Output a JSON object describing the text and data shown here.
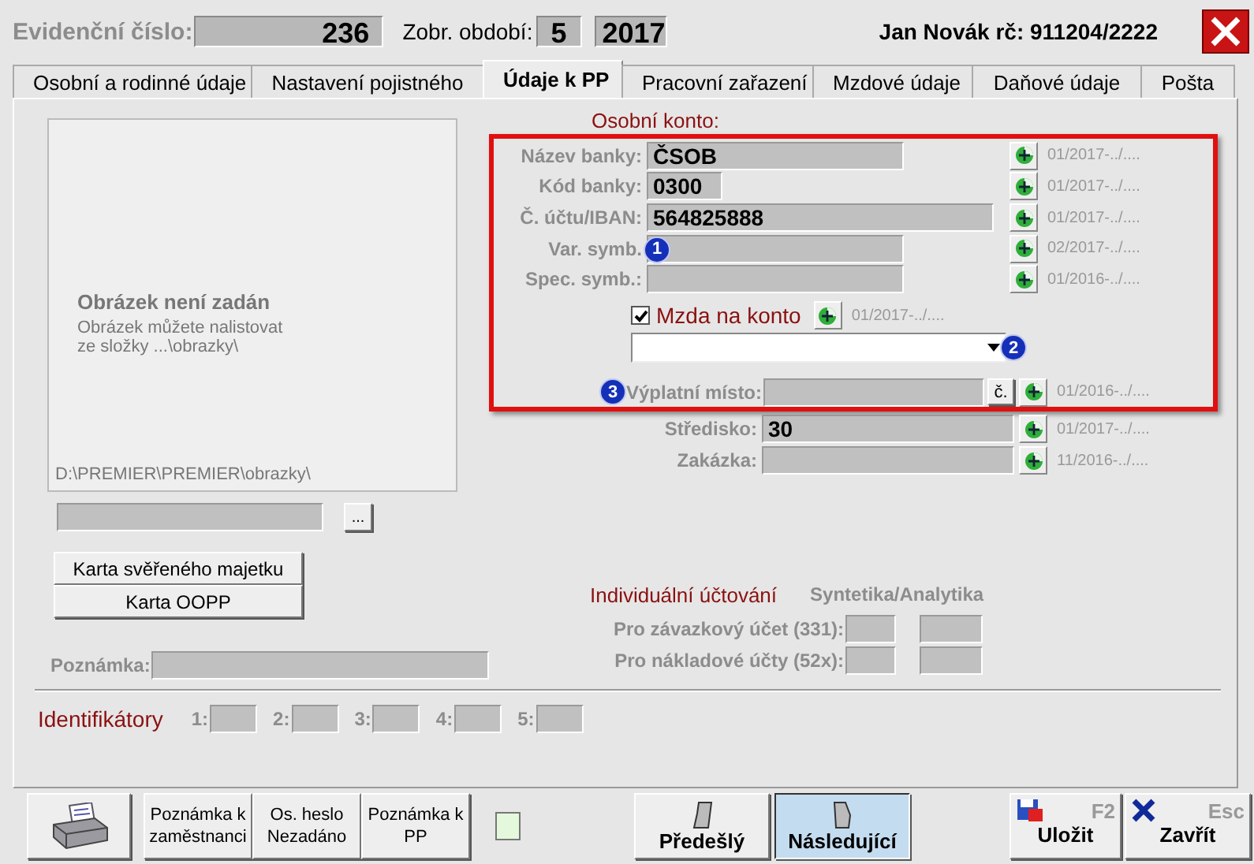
{
  "header": {
    "evidence_label": "Evidenční číslo:",
    "evidence_value": "236",
    "period_label": "Zobr. období:",
    "period_month": "5",
    "period_year": "2017",
    "person": "Jan Novák rč: 911204/2222"
  },
  "tabs": [
    {
      "label": "Osobní a rodinné údaje",
      "selected": false
    },
    {
      "label": "Nastavení pojistného",
      "selected": false
    },
    {
      "label": "Údaje k PP",
      "selected": true
    },
    {
      "label": "Pracovní zařazení",
      "selected": false
    },
    {
      "label": "Mzdové údaje",
      "selected": false
    },
    {
      "label": "Daňové údaje",
      "selected": false
    },
    {
      "label": "Pošta",
      "selected": false
    }
  ],
  "picture_panel": {
    "title": "Obrázek není zadán",
    "hint": "Obrázek můžete nalistovat\nze složky ...\\obrazky\\",
    "path": "D:\\PREMIER\\PREMIER\\obrazky\\",
    "browse_button": "..."
  },
  "card_buttons": [
    "Karta svěřeného majetku",
    "Karta OOPP"
  ],
  "note": {
    "label": "Poznámka:"
  },
  "account": {
    "heading": "Osobní konto:",
    "rows": [
      {
        "label": "Název banky:",
        "value": "ČSOB",
        "date": "01/2017-../...."
      },
      {
        "label": "Kód banky:",
        "value": "0300",
        "date": "01/2017-../...."
      },
      {
        "label": "Č. účtu/IBAN:",
        "value": "564825888",
        "date": "01/2017-../...."
      },
      {
        "label": "Var. symb.",
        "value": "",
        "badge": "1",
        "date": "02/2017-../...."
      },
      {
        "label": "Spec. symb.:",
        "value": "",
        "date": "01/2016-../...."
      }
    ],
    "salary": {
      "label": "Mzda na konto",
      "checked": true,
      "date": "01/2017-../...."
    },
    "dropdown_badge": "2",
    "payment_place": {
      "badge": "3",
      "label": "Výplatní místo:",
      "button": "č.",
      "date": "01/2016-../...."
    }
  },
  "other_rows": [
    {
      "label": "Středisko:",
      "value": "30",
      "date": "01/2017-../...."
    },
    {
      "label": "Zakázka:",
      "value": "",
      "date": "11/2016-../...."
    }
  ],
  "accounting": {
    "heading": "Individuální účtování",
    "column_heading": "Syntetika/Analytika",
    "rows": [
      {
        "label": "Pro závazkový účet (331):"
      },
      {
        "label": "Pro nákladové účty (52x):"
      }
    ]
  },
  "identifiers": {
    "label": "Identifikátory",
    "items": [
      "1:",
      "2:",
      "3:",
      "4:",
      "5:"
    ]
  },
  "toolbar": {
    "note_buttons": [
      "Poznámka k\nzaměstnanci",
      "Os. heslo\nNezadáno",
      "Poznámka k\nPP"
    ],
    "nav": [
      {
        "label": "Předešlý",
        "selected": false
      },
      {
        "label": "Následující",
        "selected": true
      }
    ],
    "actions": [
      {
        "kind": "save",
        "label": "Uložit",
        "key": "F2"
      },
      {
        "kind": "close",
        "label": "Zavřít",
        "key": "Esc"
      }
    ]
  }
}
